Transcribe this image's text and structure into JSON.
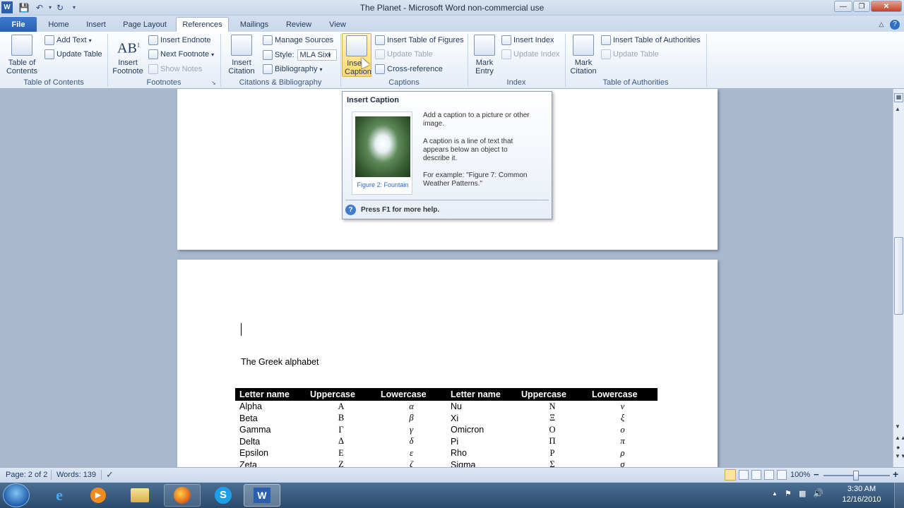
{
  "window": {
    "title": "The Planet  -  Microsoft Word non-commercial use"
  },
  "tabs": [
    "File",
    "Home",
    "Insert",
    "Page Layout",
    "References",
    "Mailings",
    "Review",
    "View"
  ],
  "ribbon": {
    "toc": {
      "big": "Table of Contents",
      "add_text": "Add Text",
      "update_table": "Update Table",
      "group": "Table of Contents"
    },
    "footnotes": {
      "big": "Insert Footnote",
      "insert_endnote": "Insert Endnote",
      "next_footnote": "Next Footnote",
      "show_notes": "Show Notes",
      "group": "Footnotes"
    },
    "citations": {
      "big": "Insert Citation",
      "manage_sources": "Manage Sources",
      "style_label": "Style:",
      "style_value": "MLA Sixt",
      "bibliography": "Bibliography",
      "group": "Citations & Bibliography"
    },
    "captions": {
      "big": "Insert Caption",
      "insert_tof": "Insert Table of Figures",
      "update_table": "Update Table",
      "cross_ref": "Cross-reference",
      "group": "Captions"
    },
    "index": {
      "big": "Mark Entry",
      "insert_index": "Insert Index",
      "update_index": "Update Index",
      "group": "Index"
    },
    "toa": {
      "big": "Mark Citation",
      "insert_toa": "Insert Table of Authorities",
      "update_table": "Update Table",
      "group": "Table of Authorities"
    }
  },
  "tooltip": {
    "title": "Insert Caption",
    "desc1": "Add a caption to a picture or other image.",
    "desc2": "A caption is a line of text that appears below an object to describe it.",
    "desc3": "For example: \"Figure 7: Common Weather Patterns.\"",
    "figure_caption": "Figure 2: Fountain",
    "help": "Press F1 for more help."
  },
  "document": {
    "heading": "The Greek alphabet",
    "table": {
      "headers": [
        "Letter name",
        "Uppercase",
        "Lowercase",
        "Letter name",
        "Uppercase",
        "Lowercase"
      ],
      "rows": [
        [
          "Alpha",
          "Α",
          "α",
          "Nu",
          "Ν",
          "ν"
        ],
        [
          "Beta",
          "Β",
          "β",
          "Xi",
          "Ξ",
          "ξ"
        ],
        [
          "Gamma",
          "Γ",
          "γ",
          "Omicron",
          "Ο",
          "ο"
        ],
        [
          "Delta",
          "Δ",
          "δ",
          "Pi",
          "Π",
          "π"
        ],
        [
          "Epsilon",
          "Ε",
          "ε",
          "Rho",
          "Ρ",
          "ρ"
        ],
        [
          "Zeta",
          "Ζ",
          "ζ",
          "Sigma",
          "Σ",
          "σ"
        ]
      ]
    }
  },
  "status": {
    "page": "Page: 2 of 2",
    "words": "Words: 139",
    "zoom": "100%"
  },
  "clock": {
    "time": "3:30 AM",
    "date": "12/16/2010"
  },
  "colors": {
    "accent": "#2a5fb0",
    "ribbon_bg": "#e4ecf7",
    "doc_bg": "#a9b8cc"
  }
}
